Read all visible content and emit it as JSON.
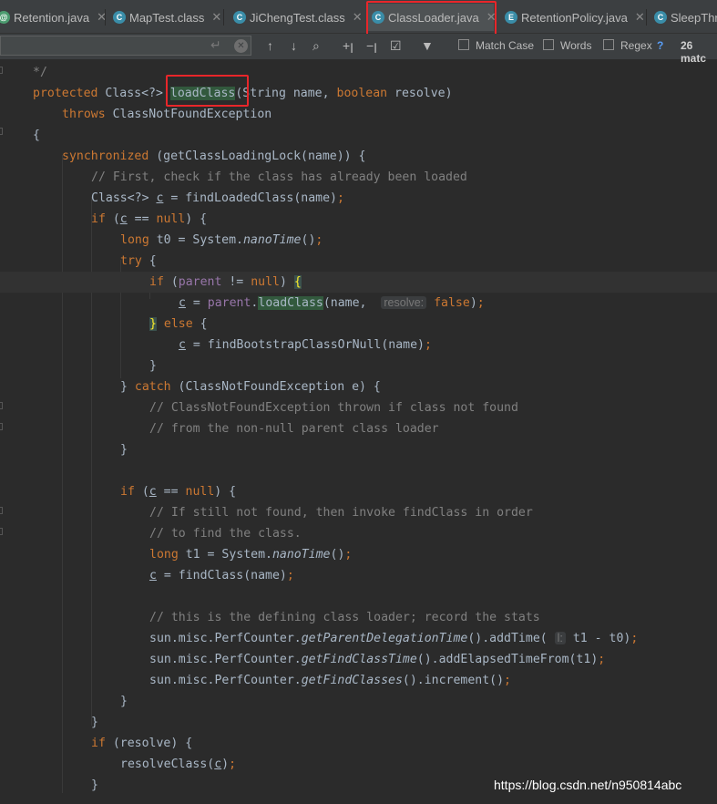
{
  "tabs": [
    {
      "label": "Retention.java",
      "icon": "java-annotation-icon",
      "icon_color": "#4b9b6f"
    },
    {
      "label": "MapTest.class",
      "icon": "class-file-icon",
      "icon_color": "#3a8da8"
    },
    {
      "label": "JiChengTest.class",
      "icon": "class-file-icon",
      "icon_color": "#3a8da8"
    },
    {
      "label": "ClassLoader.java",
      "icon": "java-class-icon",
      "icon_color": "#3a8da8",
      "active": true
    },
    {
      "label": "RetentionPolicy.java",
      "icon": "java-enum-icon",
      "icon_color": "#3a8da8"
    },
    {
      "label": "SleepThr",
      "icon": "class-file-icon",
      "icon_color": "#3a8da8"
    }
  ],
  "search": {
    "value": "",
    "placeholder": "",
    "match_case_label": "Match Case",
    "words_label": "Words",
    "regex_label": "Regex",
    "help_label": "?",
    "results_label": "26 matc"
  },
  "icons": [
    "enter-icon",
    "clear-icon",
    "arrow-up-icon",
    "arrow-down-icon",
    "find-all-icon",
    "add-selection-icon",
    "remove-selection-icon",
    "select-all-icon",
    "filter-icon"
  ],
  "code_lines": [
    "  */",
    "protected Class<?> loadClass(String name, boolean resolve)",
    "    throws ClassNotFoundException",
    "{",
    "    synchronized (getClassLoadingLock(name)) {",
    "        // First, check if the class has already been loaded",
    "        Class<?> c = findLoadedClass(name);",
    "        if (c == null) {",
    "            long t0 = System.nanoTime();",
    "            try {",
    "                if (parent != null) {",
    "                    c = parent.loadClass(name,  resolve: false);",
    "                } else {",
    "                    c = findBootstrapClassOrNull(name);",
    "                }",
    "            } catch (ClassNotFoundException e) {",
    "                // ClassNotFoundException thrown if class not found",
    "                // from the non-null parent class loader",
    "            }",
    "",
    "            if (c == null) {",
    "                // If still not found, then invoke findClass in order",
    "                // to find the class.",
    "                long t1 = System.nanoTime();",
    "                c = findClass(name);",
    "",
    "                // this is the defining class loader; record the stats",
    "                sun.misc.PerfCounter.getParentDelegationTime().addTime( l: t1 - t0);",
    "                sun.misc.PerfCounter.getFindClassTime().addElapsedTimeFrom(t1);",
    "                sun.misc.PerfCounter.getFindClasses().increment();",
    "            }",
    "        }",
    "        if (resolve) {",
    "            resolveClass(c);",
    "        }"
  ],
  "watermark": "https://blog.csdn.net/n950814abc",
  "colors": {
    "keyword": "#cc7832",
    "comment": "#808080",
    "field": "#9876aa",
    "text": "#a9b7c6",
    "background": "#2b2b2b",
    "highlight": "#e8262a"
  }
}
